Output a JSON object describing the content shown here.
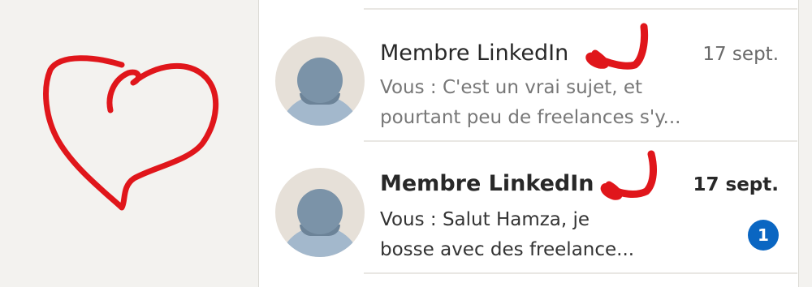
{
  "conversations": [
    {
      "name": "Membre LinkedIn",
      "date": "17 sept.",
      "preview_line1": "Vous : C'est un vrai sujet, et",
      "preview_line2": "pourtant peu de freelances s'y...",
      "unread": false
    },
    {
      "name": "Membre LinkedIn",
      "date": "17 sept.",
      "preview_line1": "Vous : Salut Hamza, je",
      "preview_line2": "bosse avec des freelance...",
      "unread": true,
      "unread_count": "1"
    }
  ],
  "icons": {
    "avatar": "default-profile-avatar-icon",
    "annotation_heart": "hand-drawn-heart",
    "annotation_arrow": "hand-drawn-arrow"
  },
  "colors": {
    "page_background": "#f3f2ef",
    "panel_background": "#ffffff",
    "badge": "#0a66c2",
    "annotation": "#e0161b"
  }
}
